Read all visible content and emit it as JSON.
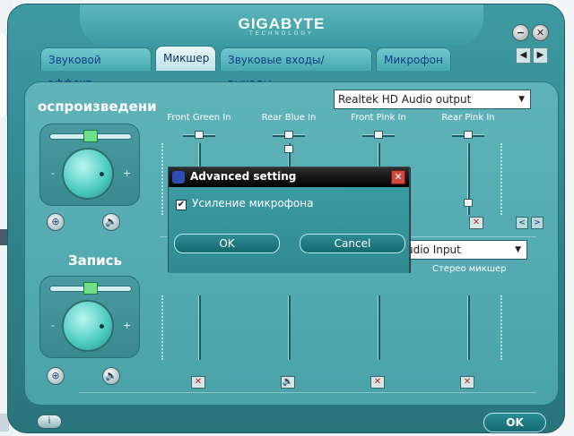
{
  "window": {
    "brand": "GIGABYTE",
    "brand_sub": "TECHNOLOGY",
    "minimize_glyph": "−",
    "close_glyph": "✕"
  },
  "tabs": [
    {
      "label": "Звуковой эффект",
      "active": false
    },
    {
      "label": "Микшер",
      "active": true
    },
    {
      "label": "Звуковые входы/выходы",
      "active": false
    },
    {
      "label": "Микрофон",
      "active": false
    }
  ],
  "tab_nav": {
    "prev": "◀",
    "next": "▶"
  },
  "playback": {
    "title": "оспроизведени",
    "volume_minus": "-",
    "volume_plus": "+",
    "device_select": "Realtek HD Audio output",
    "channels": [
      {
        "label": "Front Green In"
      },
      {
        "label": "Rear Blue In"
      },
      {
        "label": "Front Pink In"
      },
      {
        "label": "Rear Pink In"
      }
    ],
    "nav_prev": "<",
    "nav_next": ">"
  },
  "record": {
    "title": "Запись",
    "volume_minus": "-",
    "volume_plus": "+",
    "device_select": "udio Input",
    "stereo_mixer_label": "Стерео микшер"
  },
  "footer": {
    "info_label": "i",
    "ok_label": "OK"
  },
  "dialog": {
    "title": "Advanced setting",
    "close_glyph": "✕",
    "checkbox_label": "Усиление микрофона",
    "checkbox_checked": true,
    "ok_label": "OK",
    "cancel_label": "Cancel"
  },
  "icons": {
    "mute": "✕",
    "speaker": "🔈",
    "connector": "⊕"
  },
  "colors": {
    "frame": "#2f8189",
    "panel": "#4ba3aa",
    "dialog_title": "#000000",
    "tab_text": "#123a8a"
  }
}
